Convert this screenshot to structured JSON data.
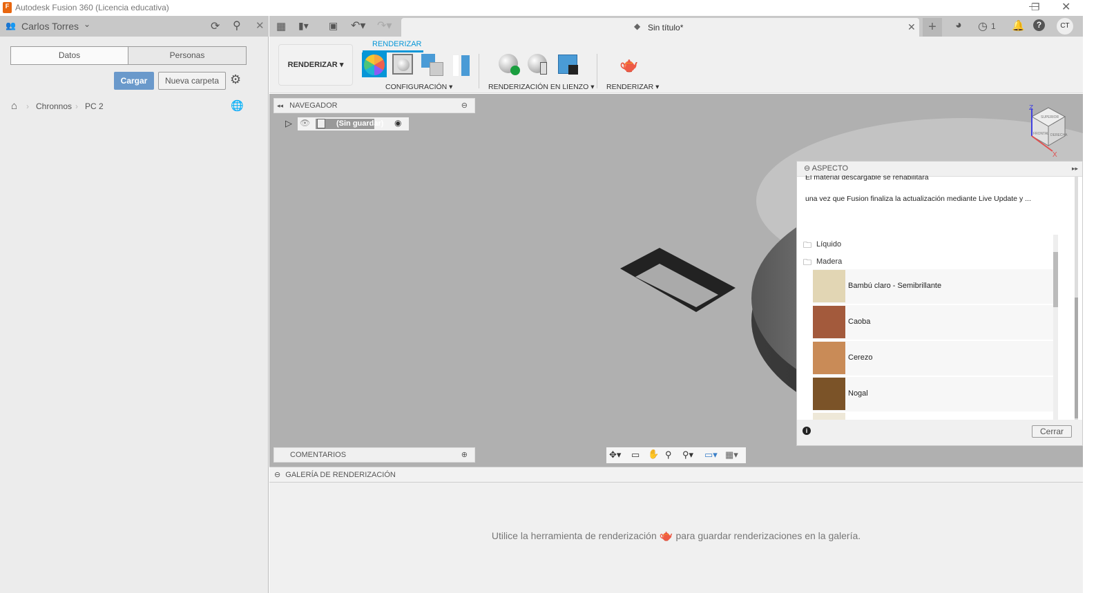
{
  "window": {
    "title": "Autodesk Fusion 360 (Licencia educativa)",
    "app_icon_letter": "F"
  },
  "data_panel": {
    "user": "Carlos Torres",
    "tabs": [
      "Datos",
      "Personas"
    ],
    "upload_label": "Cargar",
    "new_folder_label": "Nueva carpeta",
    "breadcrumb": [
      "Chronnos",
      "PC 2"
    ]
  },
  "toolbar": {
    "document_title": "Sin título*",
    "job_count": "1",
    "user_initials": "CT"
  },
  "ribbon": {
    "active_tab": "RENDERIZAR",
    "workspace": "RENDERIZAR",
    "groups": [
      "CONFIGURACIÓN",
      "RENDERIZACIÓN EN LIENZO",
      "RENDERIZAR"
    ],
    "accent": "#0696d7"
  },
  "browser": {
    "title": "NAVEGADOR",
    "root": "(Sin guardar)"
  },
  "comments": {
    "title": "COMENTARIOS"
  },
  "viewcube": {
    "faces": [
      "SUPERIOR",
      "FRONTAL",
      "DERECHA"
    ],
    "axes": [
      "Z",
      "X"
    ]
  },
  "aspect": {
    "title": "ASPECTO",
    "message_line1": "El material descargable se rehabilitará",
    "message_line2": "una vez que Fusion finaliza la actualización mediante Live Update y ...",
    "folders": [
      "Líquido",
      "Madera"
    ],
    "materials": [
      {
        "name": "Bambú claro - Semibrillante",
        "color": "#e2d6b4"
      },
      {
        "name": "Caoba",
        "color": "#a35a3c"
      },
      {
        "name": "Cerezo",
        "color": "#c98b57"
      },
      {
        "name": "Nogal",
        "color": "#7b5328"
      }
    ],
    "close_label": "Cerrar"
  },
  "gallery": {
    "title": "GALERÍA DE RENDERIZACIÓN",
    "hint_before": "Utilice la herramienta de renderización",
    "hint_after": "para guardar renderizaciones en la galería."
  }
}
